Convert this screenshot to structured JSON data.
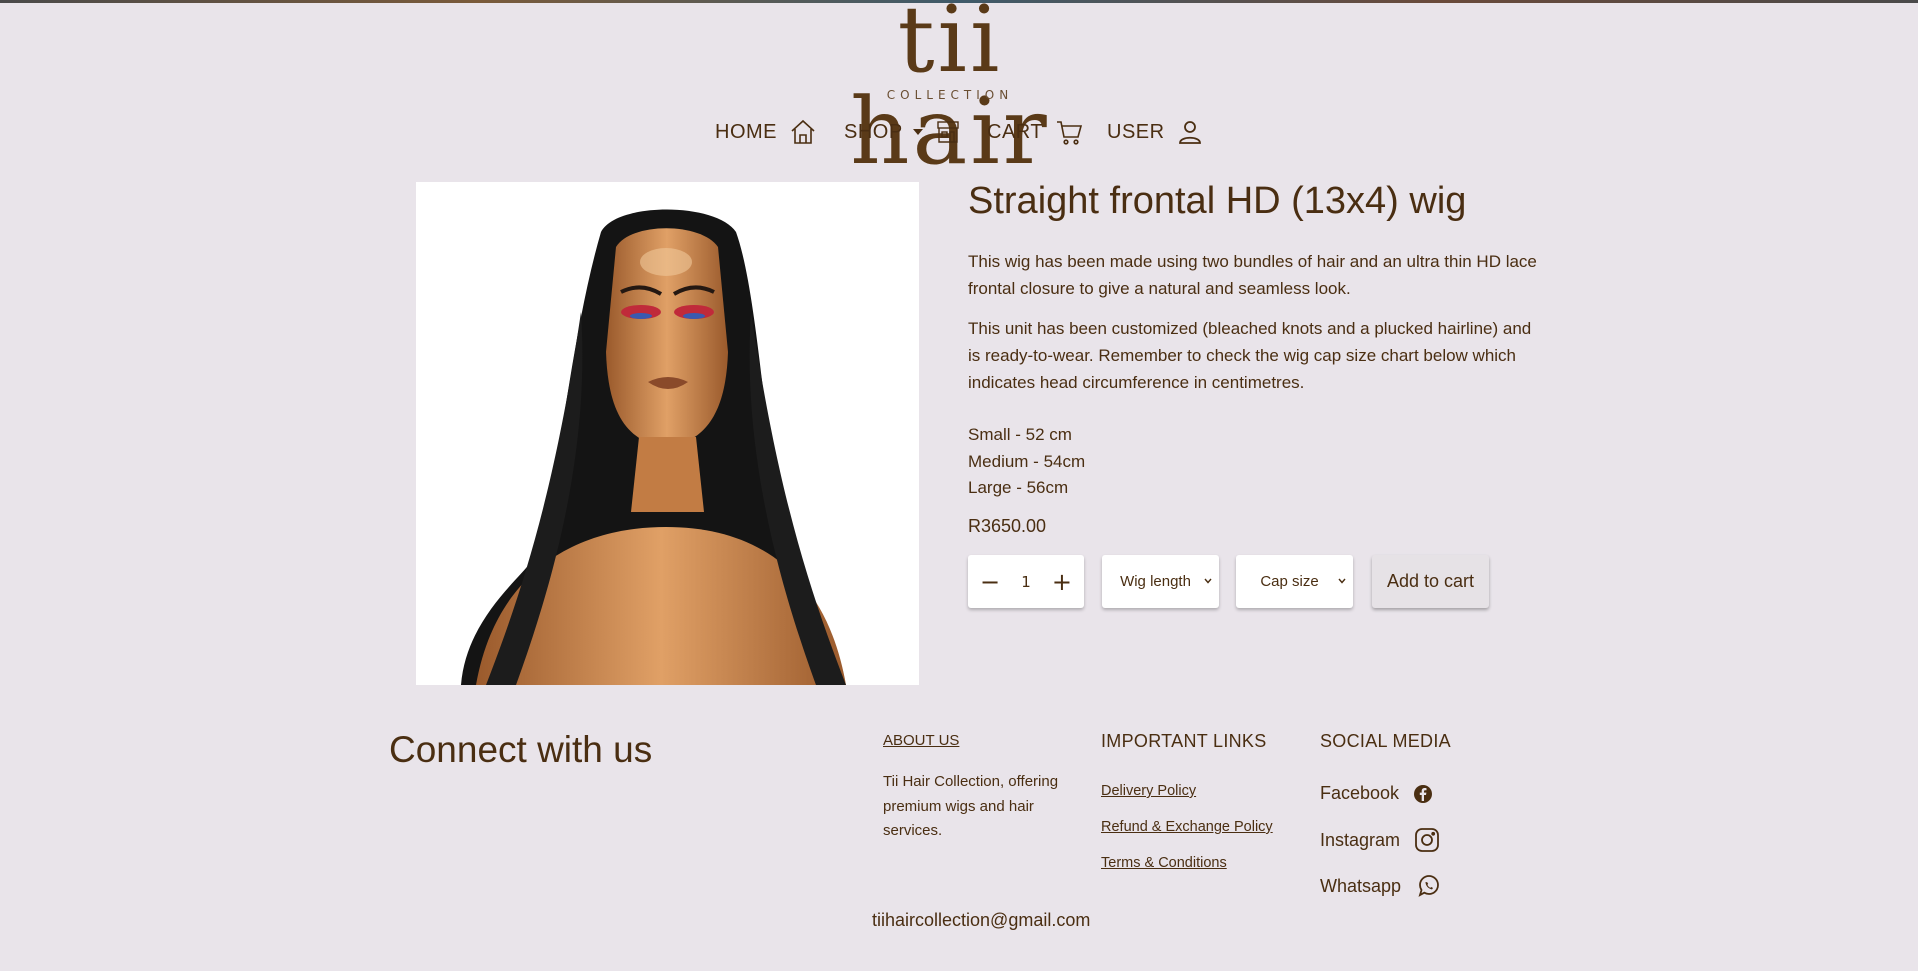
{
  "brand": {
    "logo_text": "tii hair",
    "logo_subtext": "COLLECTION"
  },
  "nav": {
    "items": [
      {
        "label": "HOME",
        "icon": "home-icon"
      },
      {
        "label": "SHOP",
        "icon": "store-icon"
      },
      {
        "label": "CART",
        "icon": "cart-icon"
      },
      {
        "label": "USER",
        "icon": "user-icon"
      }
    ]
  },
  "product": {
    "title": "Straight frontal HD (13x4) wig",
    "description_1": "This wig has been made using two bundles of hair and an ultra thin HD lace frontal closure to give a natural and seamless look.",
    "description_2": "This unit has been customized (bleached knots and a plucked hairline) and is ready-to-wear. Remember to check the wig cap size chart below which indicates head circumference in centimetres.",
    "sizes": [
      "Small - 52 cm",
      "Medium - 54cm",
      "Large - 56cm"
    ],
    "price": "R3650.00",
    "quantity": "1",
    "wig_length_select": "Wig length",
    "cap_size_select": "Cap size",
    "add_to_cart": "Add to cart"
  },
  "footer": {
    "connect_heading": "Connect with us",
    "about_link": "ABOUT US",
    "about_text": "Tii Hair Collection, offering premium wigs and hair services.",
    "important_links_heading": "IMPORTANT LINKS",
    "important_links": [
      "Delivery Policy",
      "Refund & Exchange Policy",
      "Terms & Conditions"
    ],
    "social_heading": "SOCIAL MEDIA",
    "social_links": [
      {
        "label": "Facebook",
        "icon": "facebook-icon"
      },
      {
        "label": "Instagram",
        "icon": "instagram-icon"
      },
      {
        "label": "Whatsapp",
        "icon": "whatsapp-icon"
      }
    ],
    "email": "tiihaircollection@gmail.com"
  },
  "colors": {
    "background": "#e9e4ea",
    "brand_brown": "#4a2e12",
    "image_bg": "#ffffff"
  }
}
